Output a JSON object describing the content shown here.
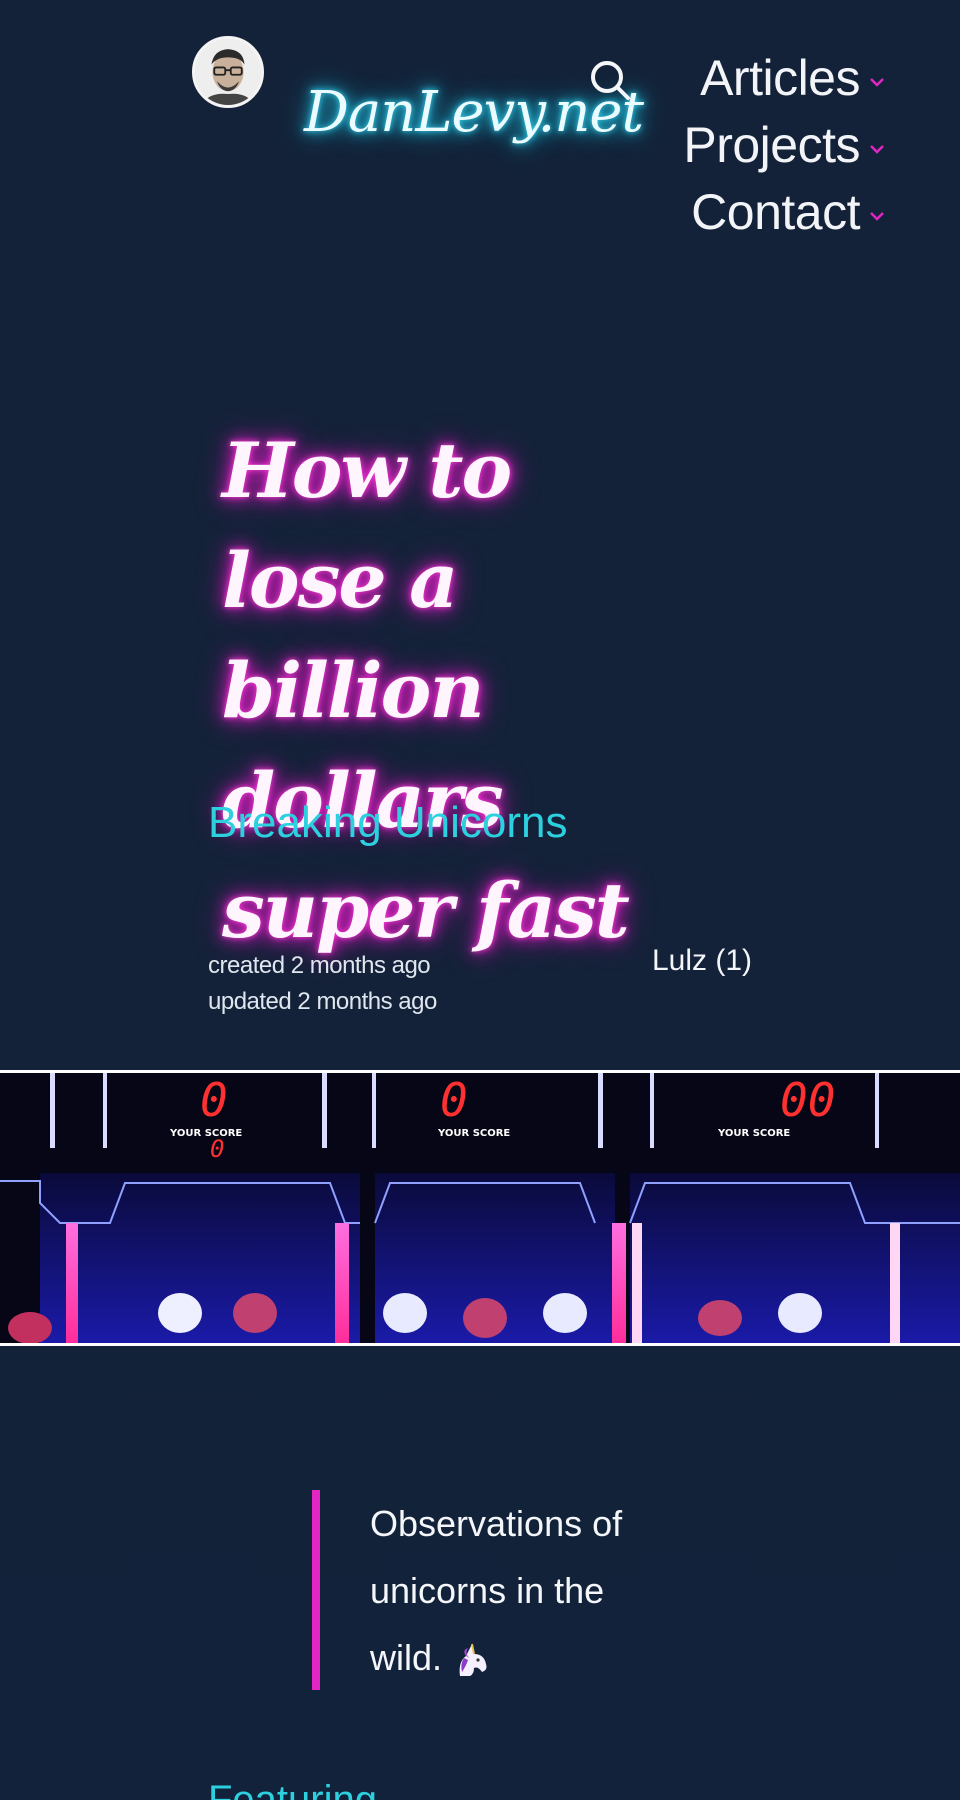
{
  "header": {
    "brand": "DanLevy.net",
    "nav": [
      {
        "label": "Articles"
      },
      {
        "label": "Projects"
      },
      {
        "label": "Contact"
      }
    ],
    "icons": {
      "search": "search-icon",
      "caret": "chevron-down-icon",
      "avatar": "avatar"
    }
  },
  "post": {
    "title": "How to lose a billion dollars super fast",
    "category": "Breaking Unicorns",
    "created": "created 2 months ago",
    "updated": "updated 2 months ago",
    "tag": "Lulz (1)",
    "banner_scores": [
      "0",
      "0",
      "0",
      "00"
    ],
    "banner_labels": [
      "YOUR SCORE",
      "YOUR SCORE",
      "YOUR SCORE"
    ],
    "quote": "Observations of unicorns in the wild.",
    "quote_emoji": "unicorn-icon",
    "next_section": "Featuring"
  },
  "colors": {
    "background": "#132238",
    "brand_glow": "#22c6e6",
    "title_glow": "#e11fc7",
    "accent": "#2cd0df",
    "quote_border": "#e126c4",
    "caret": "#e126c4"
  }
}
